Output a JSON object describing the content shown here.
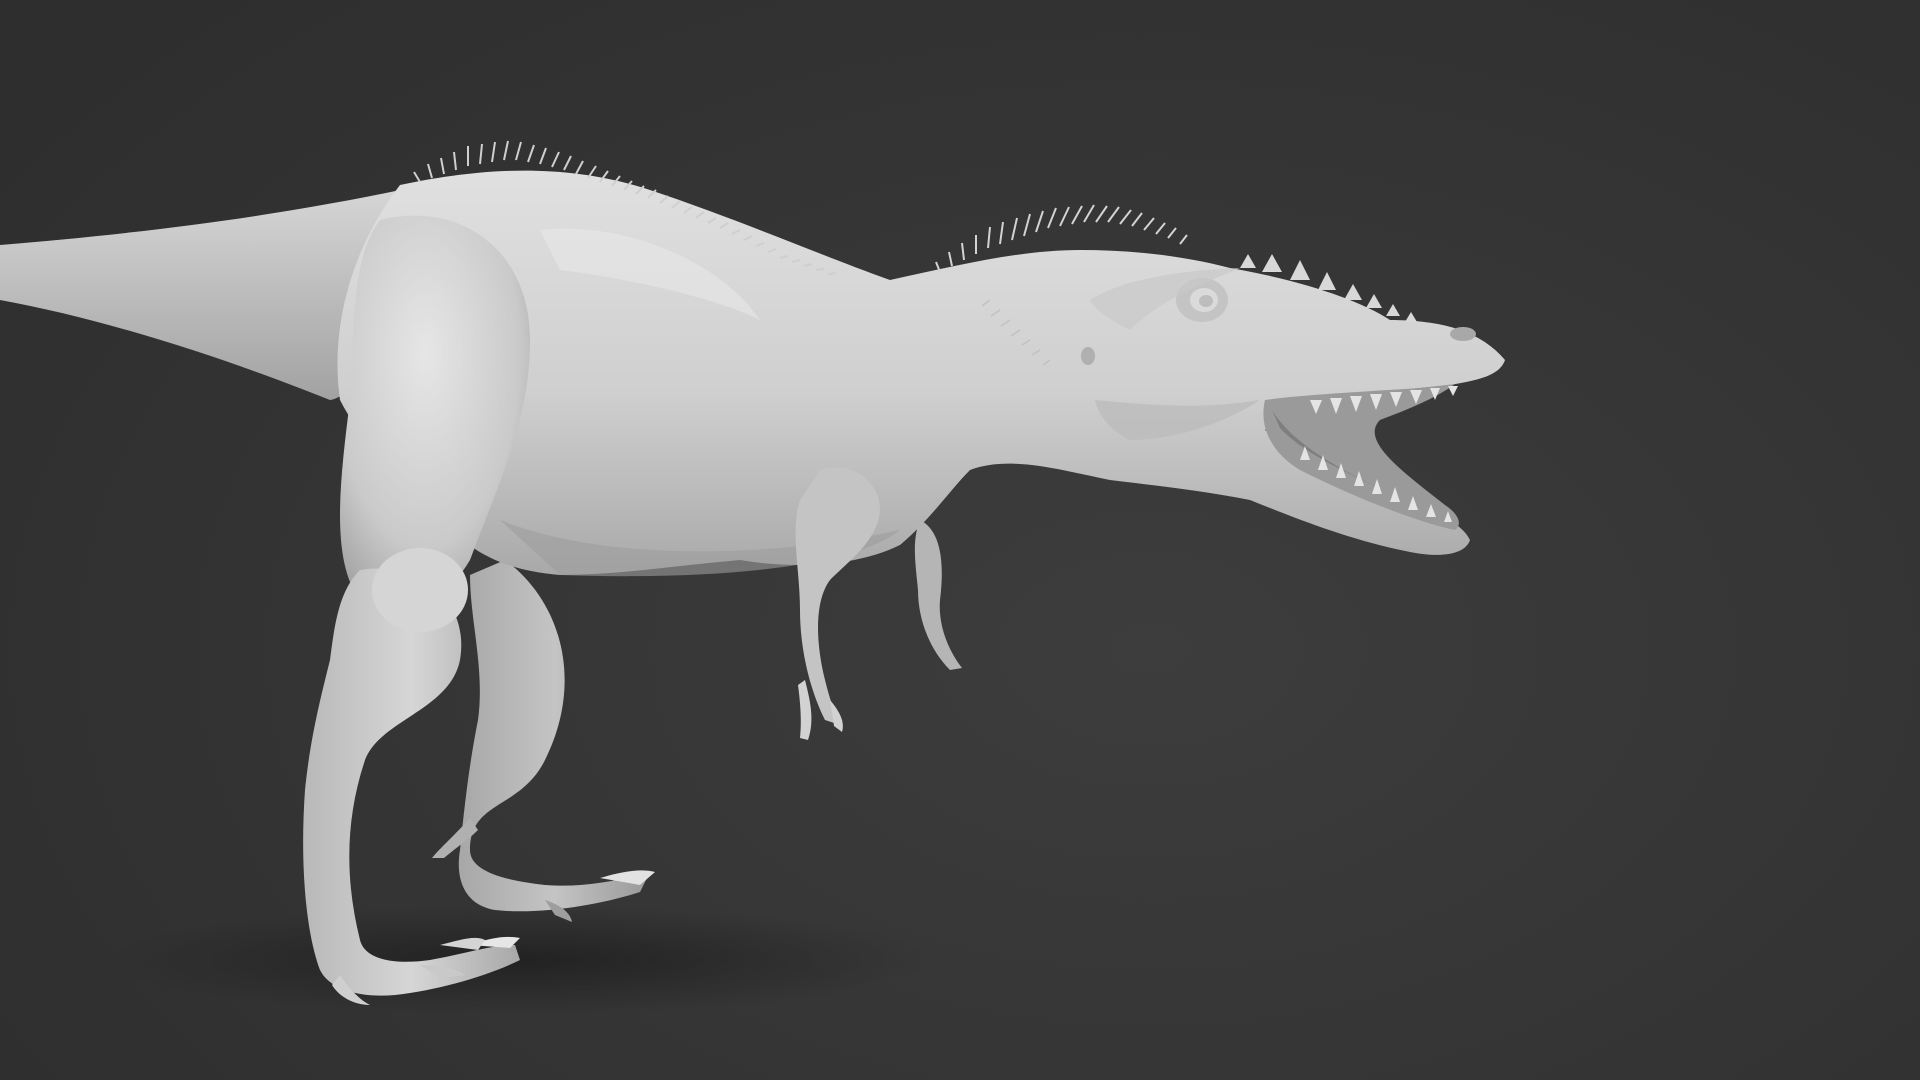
{
  "scene": {
    "subject": "theropod-sculpt",
    "colors": {
      "background": "#353535",
      "background_center": "#3d3d3d",
      "model_light": "#d9d9d9",
      "model_mid": "#bdbdbd",
      "model_shadow": "#8e8e8e",
      "mouth_interior": "#9a9a9a"
    }
  }
}
